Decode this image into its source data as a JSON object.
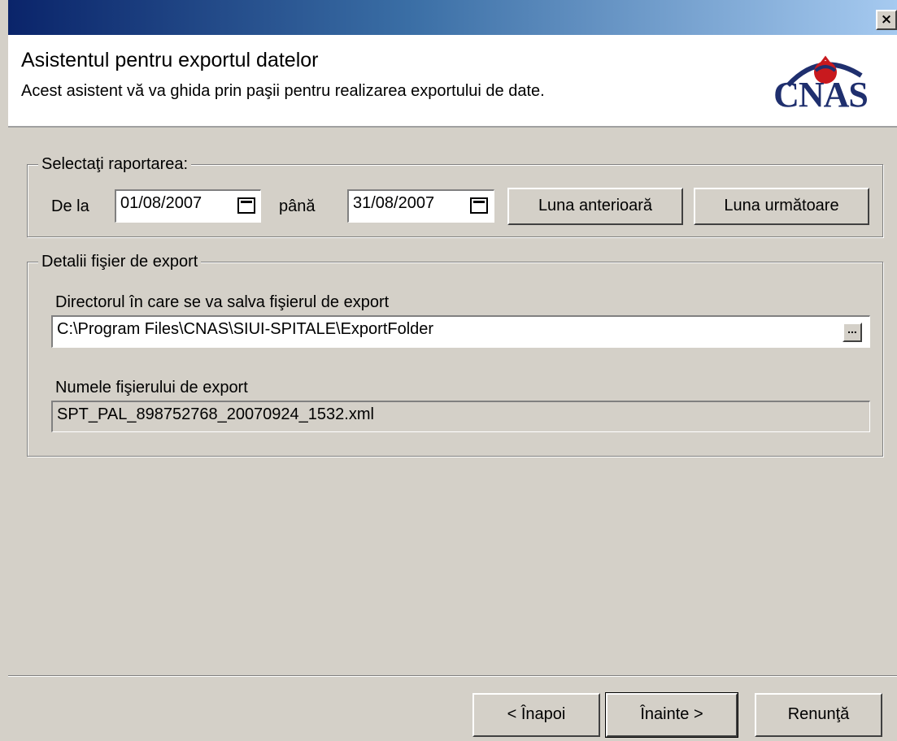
{
  "window": {
    "close_glyph": "×"
  },
  "header": {
    "title": "Asistentul pentru exportul datelor",
    "subtitle": "Acest asistent vă va ghida prin paşii pentru realizarea exportului de date.",
    "logo_text": "CNAS",
    "logo_colors": {
      "navy": "#1f2f6e",
      "red": "#c8191e"
    }
  },
  "report_selection": {
    "legend": "Selectaţi raportarea:",
    "from_label": "De la",
    "from_date": "01/08/2007",
    "to_label": "până",
    "to_date": "31/08/2007",
    "prev_month_label": "Luna anterioară",
    "next_month_label": "Luna următoare",
    "calendar_icon": "calendar-icon"
  },
  "export_details": {
    "legend": "Detalii fişier de export",
    "dir_label": "Directorul în care se va salva fişierul de export",
    "dir_value": "C:\\Program Files\\CNAS\\SIUI-SPITALE\\ExportFolder",
    "browse_glyph": "...",
    "filename_label": "Numele fişierului de export",
    "filename_value": "SPT_PAL_898752768_20070924_1532.xml"
  },
  "footer": {
    "back_label": "< Înapoi",
    "next_label": "Înainte >",
    "cancel_label": "Renunţă"
  }
}
